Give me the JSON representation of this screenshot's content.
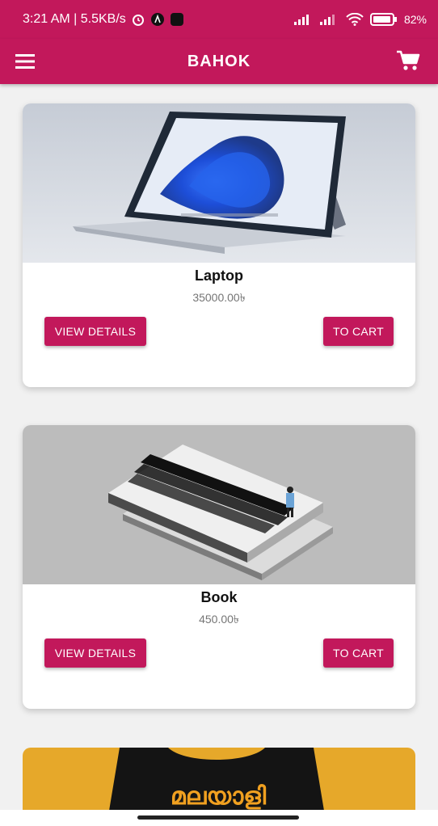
{
  "status": {
    "time_speed": "3:21 AM | 5.5KB/s",
    "battery": "82%"
  },
  "appbar": {
    "title": "BAHOK"
  },
  "products": [
    {
      "name": "Laptop",
      "price": "35000.00৳",
      "details_label": "VIEW DETAILS",
      "cart_label": "TO CART"
    },
    {
      "name": "Book",
      "price": "450.00৳",
      "details_label": "VIEW DETAILS",
      "cart_label": "TO CART"
    }
  ],
  "partial_card": {
    "image_text": "മലയാളി"
  },
  "colors": {
    "primary": "#c2185b",
    "background": "#f1f1f1"
  },
  "icons": [
    "menu-icon",
    "cart-icon",
    "alarm-icon",
    "wifi-icon",
    "signal-icon",
    "battery-icon"
  ]
}
